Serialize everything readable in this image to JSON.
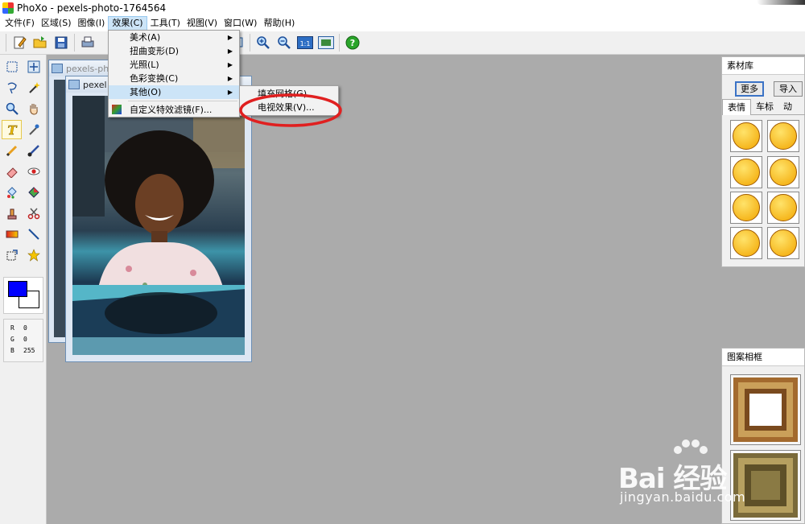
{
  "window": {
    "title": "PhoXo - pexels-photo-1764564"
  },
  "menubar": {
    "items": [
      "文件(F)",
      "区域(S)",
      "图像(I)",
      "效果(C)",
      "工具(T)",
      "视图(V)",
      "窗口(W)",
      "帮助(H)"
    ],
    "active_index": 3
  },
  "effects_menu": {
    "items": [
      {
        "label": "美术(A)",
        "submenu": true
      },
      {
        "label": "扭曲变形(D)",
        "submenu": true
      },
      {
        "label": "光照(L)",
        "submenu": true
      },
      {
        "label": "色彩变换(C)",
        "submenu": true
      },
      {
        "label": "其他(O)",
        "submenu": true,
        "highlighted": true
      },
      {
        "label": "自定义特效滤镜(F)...",
        "submenu": false
      }
    ]
  },
  "other_submenu": {
    "items": [
      "填充网格(G)",
      "电视效果(V)..."
    ]
  },
  "documents": {
    "back_title": "pexels-ph",
    "front_title": "pexel"
  },
  "colors": {
    "foreground": "#0000ff",
    "background": "#ffffff",
    "annotation": "#e02020"
  },
  "rgb": {
    "r_label": "R",
    "r": "0",
    "g_label": "G",
    "g": "0",
    "b_label": "B",
    "b": "255"
  },
  "material_panel": {
    "title": "素材库",
    "more_button": "更多",
    "import_button": "导入",
    "tabs": [
      "表情",
      "车标",
      "动"
    ]
  },
  "frame_panel": {
    "title": "图案相框"
  },
  "watermark": {
    "brand": "Bai 经验",
    "url": "jingyan.baidu.com"
  }
}
